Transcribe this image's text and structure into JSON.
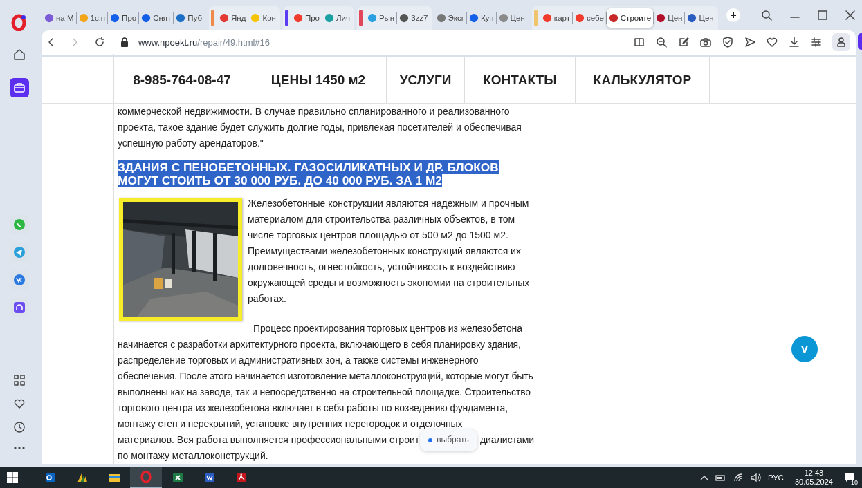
{
  "browser": {
    "tab_groups": [
      {
        "tabs": [
          {
            "label": "на М",
            "selected": false
          },
          {
            "label": "1с.п",
            "selected": false
          },
          {
            "label": "Про",
            "selected": false
          },
          {
            "label": "Снят",
            "selected": false
          },
          {
            "label": "Пуб",
            "selected": false
          }
        ]
      },
      {
        "color": "#f08a4b",
        "tabs": [
          {
            "label": "Янд",
            "selected": false
          },
          {
            "label": "Кон",
            "selected": false
          }
        ]
      },
      {
        "color": "#5b3cf5",
        "tabs": [
          {
            "label": "Про",
            "selected": false
          },
          {
            "label": "Лич",
            "selected": false
          }
        ]
      },
      {
        "color": "#e2465a",
        "tabs": [
          {
            "label": "Рын",
            "selected": false
          },
          {
            "label": "3zz7",
            "selected": false
          }
        ]
      },
      {
        "tabs": [
          {
            "label": "Эксг",
            "selected": false
          },
          {
            "label": "Куп",
            "selected": false
          },
          {
            "label": "Цен",
            "selected": false
          }
        ]
      },
      {
        "color": "#f0c36d",
        "tabs": [
          {
            "label": "карт",
            "selected": false
          },
          {
            "label": "себе",
            "selected": false
          },
          {
            "label": "Строите",
            "selected": true
          },
          {
            "label": "Цен",
            "selected": false
          },
          {
            "label": "Цен",
            "selected": false
          }
        ]
      }
    ],
    "url": {
      "host": "www.npoekt.ru",
      "path": "/repair/49.html#16"
    }
  },
  "site_nav": [
    "8-985-764-08-47",
    "ЦЕНЫ 1450 м2",
    "УСЛУГИ",
    "КОНТАКТЫ",
    "КАЛЬКУЛЯТОР"
  ],
  "article": {
    "paragraphs": [
      "коммерческой недвижимости. В случае правильно спланированного и реализованного проекта, такое здание будет служить долгие годы, привлекая посетителей и обеспечивая успешную работу арендаторов.\""
    ],
    "heading": "ЗДАНИЯ С ПЕНОБЕТОННЫХ. ГАЗОСИЛИКАТНЫХ И ДР. БЛОКОВ МОГУТ СТОИТЬ ОТ 30 000 РУБ. ДО 40 000 РУБ. ЗА 1 М2",
    "photo": {
      "kind": "picture"
    },
    "body": "Железобетонные конструкции являются надежным и прочным материалом для строительства различных объектов, в том числе торговых центров площадью от 500 м2 до 1500 м2. Преимуществами железобетонных конструкций являются их долговечность, огнестойкость, устойчивость к воздействию окружающей среды и возможность экономии на строительных работах.",
    "process": "Процесс проектирования торговых центров из железобетона начинается с разработки архитектурного проекта, включающего в себя планировку здания, распределение торговых и административных зон, а также системы инженерного обеспечения. После этого начинается изготовление металлоконструкций, которые могут быть выполнены как на заводе, так и непосредственно на строительной площадке. Строительство торгового центра из железобетона включает в себя работы по возведению фундамента, монтажу стен и перекрытий, установке внутренних перегородок и отделочных",
    "covered_line_start": "материалов. Вся работа выполняется профессиональными строит",
    "covered_line_end": "диалистами",
    "last_line": "по монтажу металлоконструкций."
  },
  "scroll_button": {
    "label": "v"
  },
  "popup": {
    "label": "выбрать"
  },
  "taskbar": {
    "apps": [
      {
        "kind": "outlook",
        "selected": false
      },
      {
        "kind": "dynamics",
        "selected": false
      },
      {
        "kind": "explorer",
        "selected": false
      },
      {
        "kind": "opera",
        "selected": true
      },
      {
        "kind": "excel",
        "selected": false
      },
      {
        "kind": "word",
        "selected": false
      },
      {
        "kind": "acrobat",
        "selected": false
      }
    ],
    "language": "РУС",
    "time": "12:43",
    "date": "30.05.2024",
    "notification_count": "10"
  }
}
